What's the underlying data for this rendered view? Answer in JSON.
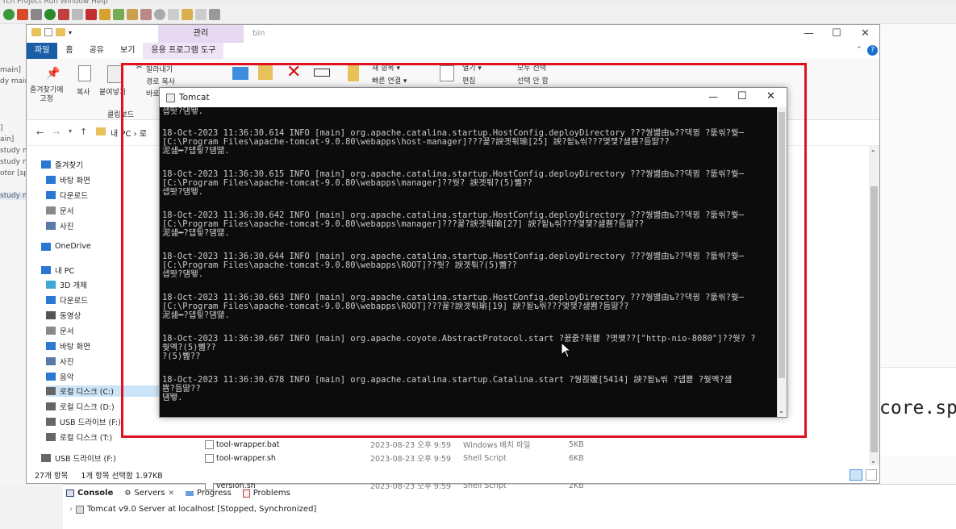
{
  "eclipse": {
    "menubar": "rch  Project  Run  Window  Help",
    "left_fragments": [
      "main]",
      "dy main",
      "]",
      "ain]",
      "study mai",
      "study n",
      "otor [sp",
      "study ma"
    ],
    "code_fragment": "core.sp",
    "console_tabs": [
      {
        "label": "Console",
        "icon": "console-icon"
      },
      {
        "label": "Servers",
        "icon": "servers-icon",
        "close": "✕"
      },
      {
        "label": "Progress",
        "icon": "progress-icon"
      },
      {
        "label": "Problems",
        "icon": "problems-icon"
      }
    ],
    "console_line": "Tomcat v9.0 Server at localhost  [Stopped, Synchronized]"
  },
  "explorer": {
    "title": "bin",
    "manage_tab": "관리",
    "ribbon_tabs": [
      "파일",
      "홈",
      "공유",
      "보기",
      "응용 프로그램 도구"
    ],
    "ribbon": {
      "pin_label": "즐겨찾기에\n고정",
      "copy_label": "복사",
      "paste_label": "붙여넣기",
      "cut_label": "잘라내기",
      "copy_path_label": "경로 복사",
      "shortcut_label": "바로",
      "clipboard_group": "클립보드",
      "new_item_label": "새 항목 ▾",
      "quick_access_label": "빠른 연결 ▾",
      "open_label": "열기 ▾",
      "edit_label": "편집",
      "select_all_label": "모두 선택",
      "select_none_label": "선택 안 함"
    },
    "address": "내 PC  ›  로",
    "nav_items": [
      {
        "label": "즐겨찾기",
        "icon": "star-icon",
        "color": "#2b78d4"
      },
      {
        "label": "바탕 화면",
        "icon": "desktop-icon",
        "color": "#2b78d4"
      },
      {
        "label": "다운로드",
        "icon": "download-icon",
        "color": "#2b78d4"
      },
      {
        "label": "문서",
        "icon": "document-icon",
        "color": "#8a8a8a"
      },
      {
        "label": "사진",
        "icon": "pictures-icon",
        "color": "#5a7aa8"
      },
      {
        "label": "OneDrive",
        "icon": "cloud-icon",
        "color": "#2b78d4"
      },
      {
        "label": "내 PC",
        "icon": "pc-icon",
        "color": "#2b78d4"
      },
      {
        "label": "3D 개체",
        "icon": "cube-icon",
        "color": "#3ba8d8"
      },
      {
        "label": "다운로드",
        "icon": "download-icon",
        "color": "#2b78d4"
      },
      {
        "label": "동영상",
        "icon": "video-icon",
        "color": "#555"
      },
      {
        "label": "문서",
        "icon": "document-icon",
        "color": "#8a8a8a"
      },
      {
        "label": "바탕 화면",
        "icon": "desktop-icon",
        "color": "#2b78d4"
      },
      {
        "label": "사진",
        "icon": "pictures-icon",
        "color": "#5a7aa8"
      },
      {
        "label": "음악",
        "icon": "music-icon",
        "color": "#2b78d4"
      },
      {
        "label": "로컬 디스크 (C:)",
        "icon": "disk-icon",
        "color": "#666"
      },
      {
        "label": "로컬 디스크 (D:)",
        "icon": "disk-icon",
        "color": "#666"
      },
      {
        "label": "USB 드라이브 (F:)",
        "icon": "usb-icon",
        "color": "#666"
      },
      {
        "label": "로컬 디스크 (T:)",
        "icon": "disk-icon",
        "color": "#666"
      },
      {
        "label": "USB 드라이브 (F:)",
        "icon": "usb-icon",
        "color": "#666"
      }
    ],
    "files": [
      {
        "name": "tool-wrapper.bat",
        "date": "2023-08-23 오후 9:59",
        "type": "Windows 배치 파일",
        "size": "5KB"
      },
      {
        "name": "tool-wrapper.sh",
        "date": "2023-08-23 오후 9:59",
        "type": "Shell Script",
        "size": "6KB"
      },
      {
        "name": "version.bat",
        "date": "2023-08-23 오후 9:59",
        "type": "Windows 배치 파일",
        "size": "2KB"
      },
      {
        "name": "version.sh",
        "date": "2023-08-23 오후 9:59",
        "type": "Shell Script",
        "size": "2KB"
      }
    ],
    "status_count": "27개 항목",
    "status_selected": "1개 항목 선택함 1.97KB"
  },
  "tomcat": {
    "title": "Tomcat",
    "log_blocks": [
      "섑똿?덈뙣.",
      "18-Oct-2023 11:36:30.614 INFO [main] org.apache.catalina.startup.HostConfig.deployDirectory ???쒕뱶由ъ??댁뀡 ?뚮씪?쒖─\n[C:\\Program Files\\apache-tomcat-9.0.80\\webapps\\host-manager]???꾩?諛곗튂瑜[25] 諛?됱ъ씪???앷쟻?섏뿀?듬땲??\n泥섎━?덉뒿?덈떎.",
      "18-Oct-2023 11:36:30.615 INFO [main] org.apache.catalina.startup.HostConfig.deployDirectory ???쒕뱶由ъ??댁뀡 ?뚮씪?쒖─\n[C:\\Program Files\\apache-tomcat-9.0.80\\webapps\\manager]??쒓? 諛곗튂?(5)뼲??\n섑똿?덈뙣.",
      "18-Oct-2023 11:36:30.642 INFO [main] org.apache.catalina.startup.HostConfig.deployDirectory ???쒕뱶由ъ??댁뀡 ?뚮씪?쒖─\n[C:\\Program Files\\apache-tomcat-9.0.80\\webapps\\manager]???꾩?諛곗튂瑜[27] 諛?됱ъ씪???앷쟻?섏뿀?듬땲??\n泥섎━?덉뒿?덈떎.",
      "18-Oct-2023 11:36:30.644 INFO [main] org.apache.catalina.startup.HostConfig.deployDirectory ???쒕뱶由ъ??댁뀡 ?뚮씪?쒖─\n[C:\\Program Files\\apache-tomcat-9.0.80\\webapps\\ROOT]??쒓? 諛곗튂?(5)뼲??\n섑똿?덈뙣.",
      "18-Oct-2023 11:36:30.663 INFO [main] org.apache.catalina.startup.HostConfig.deployDirectory ???쒕뱶由ъ??댁뀡 ?뚮씪?쒖─\n[C:\\Program Files\\apache-tomcat-9.0.80\\webapps\\ROOT]???꾩?諛곗튂瑜[19] 諛?됱ъ씪???앷쟻?섏뿀?듬땲??\n泥섎━?덉뒿?덈떎.",
      "18-Oct-2023 11:36:30.667 INFO [main] org.apache.coyote.AbstractProtocol.start ?꾨줈?좎퐳 ?몃뱾??[\"http-nio-8080\"]??쒓? ?\n쒖옉?(5)뼲??\n?(5)뼲??",
      "18-Oct-2023 11:36:30.678 INFO [main] org.apache.catalina.startup.Catalina.start ?쒕쾭媛[5414] 諛?됱ъ씪 ?덉뿉 ?쒖옉?섎\n뿀?듬땲??\n덈뙣."
    ]
  },
  "colors": {
    "highlight": "#e01020",
    "console_bg": "#0c0c0c",
    "console_text": "#cccccc",
    "ribbon_file": "#1a5ea8",
    "manage": "#e6d8f0"
  }
}
